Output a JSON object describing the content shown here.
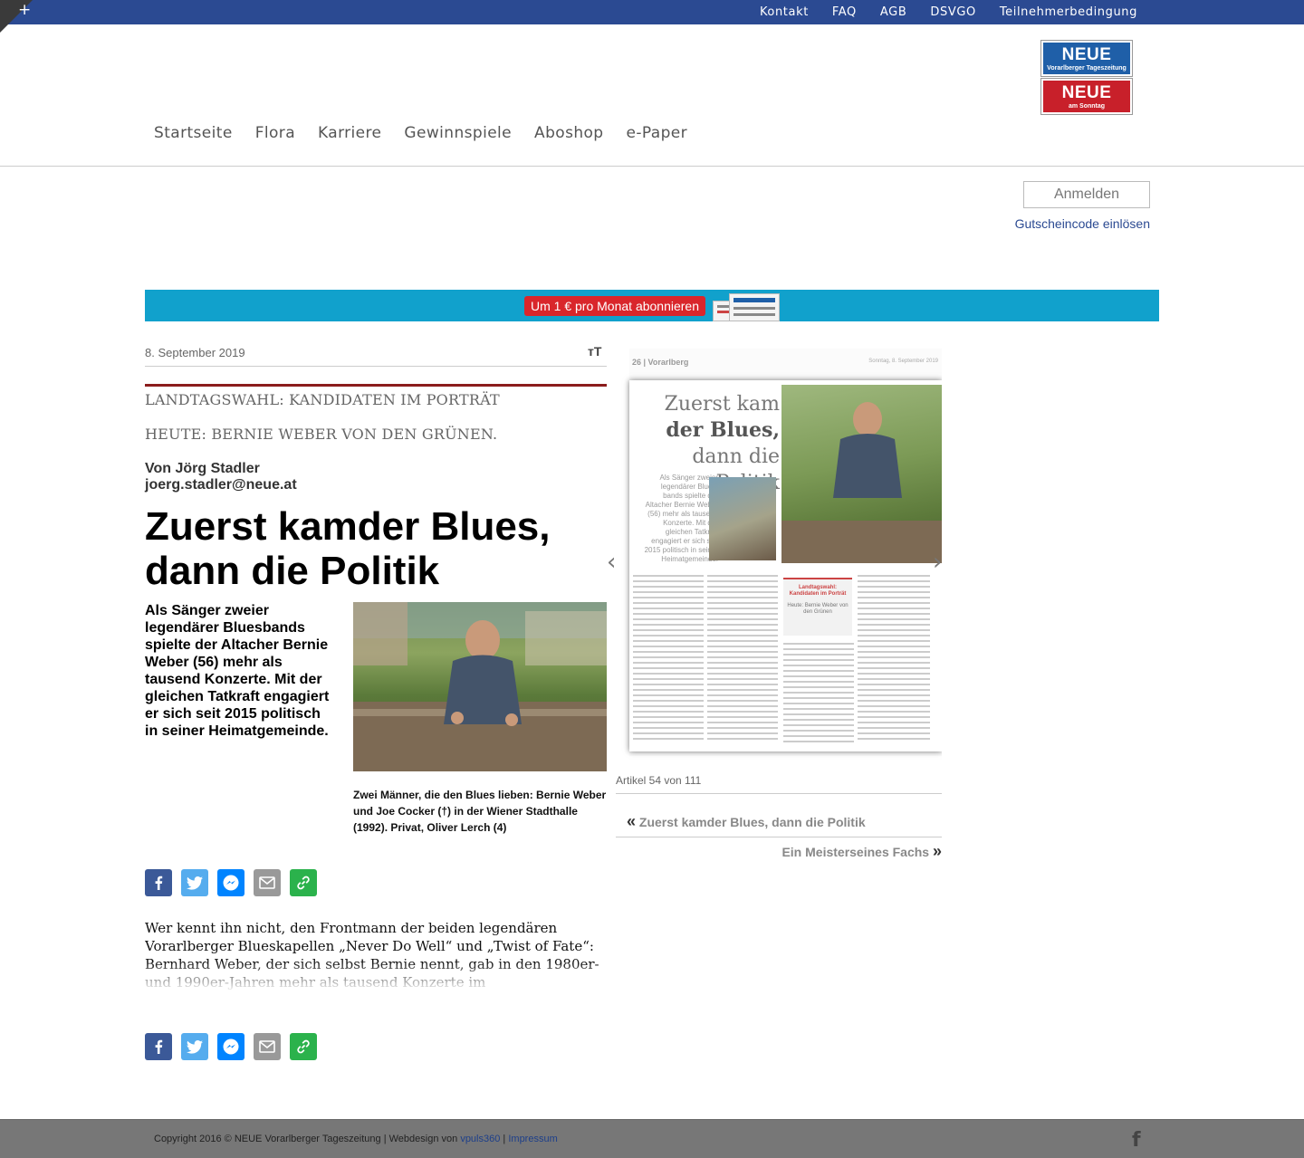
{
  "topbar": {
    "plus": "+",
    "links": [
      "Kontakt",
      "FAQ",
      "AGB",
      "DSVGO",
      "Teilnehmerbedingung"
    ]
  },
  "logos": {
    "neue_big": "NEUE",
    "neue_small": "Vorarlberger Tageszeitung",
    "sonntag_big": "NEUE",
    "sonntag_small": "am Sonntag"
  },
  "nav": [
    "Startseite",
    "Flora",
    "Karriere",
    "Gewinnspiele",
    "Aboshop",
    "e-Paper"
  ],
  "account": {
    "login": "Anmelden",
    "voucher": "Gutscheincode einlösen"
  },
  "promo": {
    "button": "Um 1 € pro Monat abonnieren"
  },
  "article": {
    "date": "8. September 2019",
    "fontsize_icon": "тT",
    "kicker1": "LANDTAGSWAHL: KANDIDATEN IM PORTRÄT",
    "kicker2": "HEUTE: BERNIE WEBER VON DEN GRÜNEN.",
    "author": "Von Jörg Stadler",
    "email": "joerg.stadler@neue.at",
    "headline": "Zuerst kamder Blues, dann die Politik",
    "lead": "Als Sänger zweier legendärer Bluesbands spielte der Altacher Bernie Weber (56) mehr als tausend Konzerte. Mit der gleichen Tatkraft engagiert er sich seit 2015 politisch in seiner Heimatgemeinde.",
    "caption": "Zwei Männer, die den Blues lieben: Bernie Weber und Joe Cocker (†) in der Wiener Stadthalle (1992). Privat, Oliver Lerch (4)",
    "body": "Wer kennt ihn nicht, den Frontmann der beiden legendären Vorarlberger Blueskapellen „Never Do Well“ und „Twist of Fate“: Bernhard Weber, der sich selbst Bernie nennt, gab in den 1980er- und 1990er-Jahren mehr als tausend Konzerte im deutschsprachigen Raum."
  },
  "epaper": {
    "page_head": "26 | Vorarlberg",
    "page_date": "Sonntag, 8. September 2019",
    "title_line1": "Zuerst kam",
    "title_line2": "der Blues,",
    "title_line3": "dann die Politik",
    "lead": "Als Sänger zweier legendärer Blues-bands spielte der Altacher Bernie Weber (56) mehr als tausend Konzerte. Mit der gleichen Tatkraft engagiert er sich seit 2015 politisch in seiner Heimatgemeinde.",
    "box_title": "Landtagswahl: Kandidaten im Porträt",
    "box_sub": "Heute: Bernie Weber von den Grünen",
    "article_count": "Artikel 54 von 111",
    "prev_quote": "«",
    "prev_title": "Zuerst kamder Blues, dann die Politik",
    "next_title": "Ein Meisterseines Fachs",
    "next_quote": "»"
  },
  "footer": {
    "text": "Copyright 2016 © NEUE Vorarlberger Tageszeitung | Webdesign von",
    "vendor": "vpuls360",
    "sep": "|",
    "impressum": "Impressum",
    "fb": "f"
  },
  "colors": {
    "topbar": "#2b4a92",
    "promo": "#11a1cc",
    "promo_button": "#d9262b",
    "kicker_rule": "#8b1c1c",
    "footer": "#777777"
  }
}
